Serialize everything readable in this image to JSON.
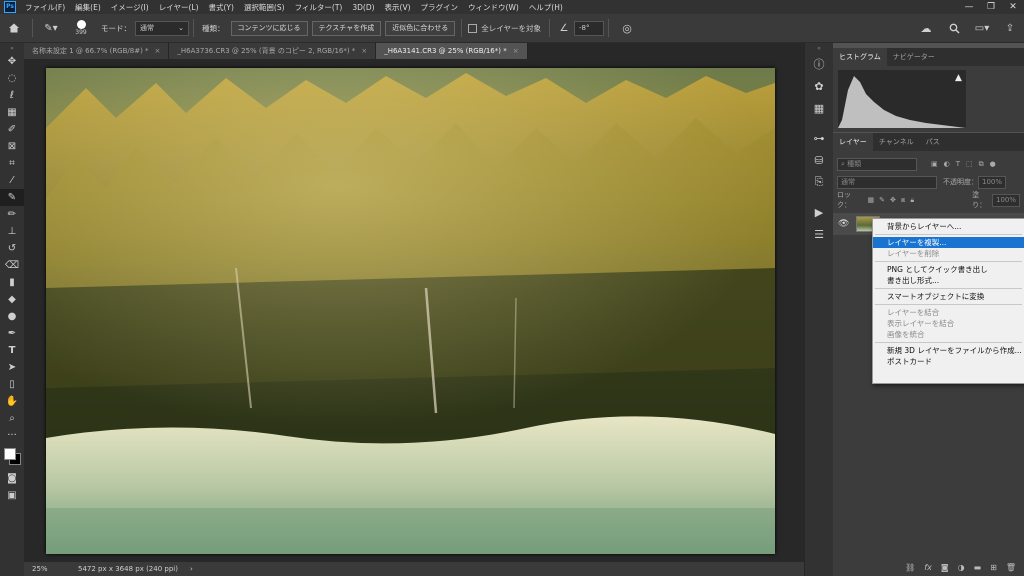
{
  "app": {
    "logo": "Ps"
  },
  "menubar": {
    "items": [
      "ファイル(F)",
      "編集(E)",
      "イメージ(I)",
      "レイヤー(L)",
      "書式(Y)",
      "選択範囲(S)",
      "フィルター(T)",
      "3D(D)",
      "表示(V)",
      "プラグイン",
      "ウィンドウ(W)",
      "ヘルプ(H)"
    ]
  },
  "options": {
    "brush_size": "399",
    "mode_label": "モード：",
    "mode_value": "通常",
    "type_label": "種類：",
    "type_buttons": [
      "コンテンツに応じる",
      "テクスチャを作成",
      "近似色に合わせる"
    ],
    "sample_all_label": "全レイヤーを対象",
    "angle_value": "-8°"
  },
  "tabs": [
    {
      "label": "名称未設定 1 @ 66.7% (RGB/8#) *",
      "active": false
    },
    {
      "label": "_H6A3736.CR3 @ 25% (背景 のコピー 2, RGB/16*) *",
      "active": false
    },
    {
      "label": "_H6A3141.CR3 @ 25% (RGB/16*) *",
      "active": true
    }
  ],
  "status": {
    "zoom": "25%",
    "doc_info": "5472 px x 3648 px (240 ppi)"
  },
  "histogram_panel": {
    "tabs": [
      "ヒストグラム",
      "ナビゲーター"
    ]
  },
  "layers_panel": {
    "tabs": [
      "レイヤー",
      "チャンネル",
      "パス"
    ],
    "filter_placeholder": "種類",
    "blend_mode": "通常",
    "opacity_label": "不透明度：",
    "opacity_value": "100%",
    "lock_label": "ロック：",
    "fill_label": "塗り：",
    "fill_value": "100%"
  },
  "context_menu": {
    "groups": [
      [
        {
          "label": "背景からレイヤーへ...",
          "state": "normal"
        }
      ],
      [
        {
          "label": "レイヤーを複製...",
          "state": "highlighted"
        },
        {
          "label": "レイヤーを削除",
          "state": "disabled"
        }
      ],
      [
        {
          "label": "PNG としてクイック書き出し",
          "state": "normal"
        },
        {
          "label": "書き出し形式...",
          "state": "normal"
        }
      ],
      [
        {
          "label": "スマートオブジェクトに変換",
          "state": "normal"
        }
      ],
      [
        {
          "label": "レイヤーを結合",
          "state": "disabled"
        },
        {
          "label": "表示レイヤーを結合",
          "state": "disabled"
        },
        {
          "label": "画像を統合",
          "state": "disabled"
        }
      ],
      [
        {
          "label": "新規 3D レイヤーをファイルから作成...",
          "state": "normal"
        },
        {
          "label": "ポストカード",
          "state": "normal"
        }
      ]
    ]
  },
  "colors": {
    "accent": "#1874d0",
    "ps_blue": "#31a8ff"
  }
}
